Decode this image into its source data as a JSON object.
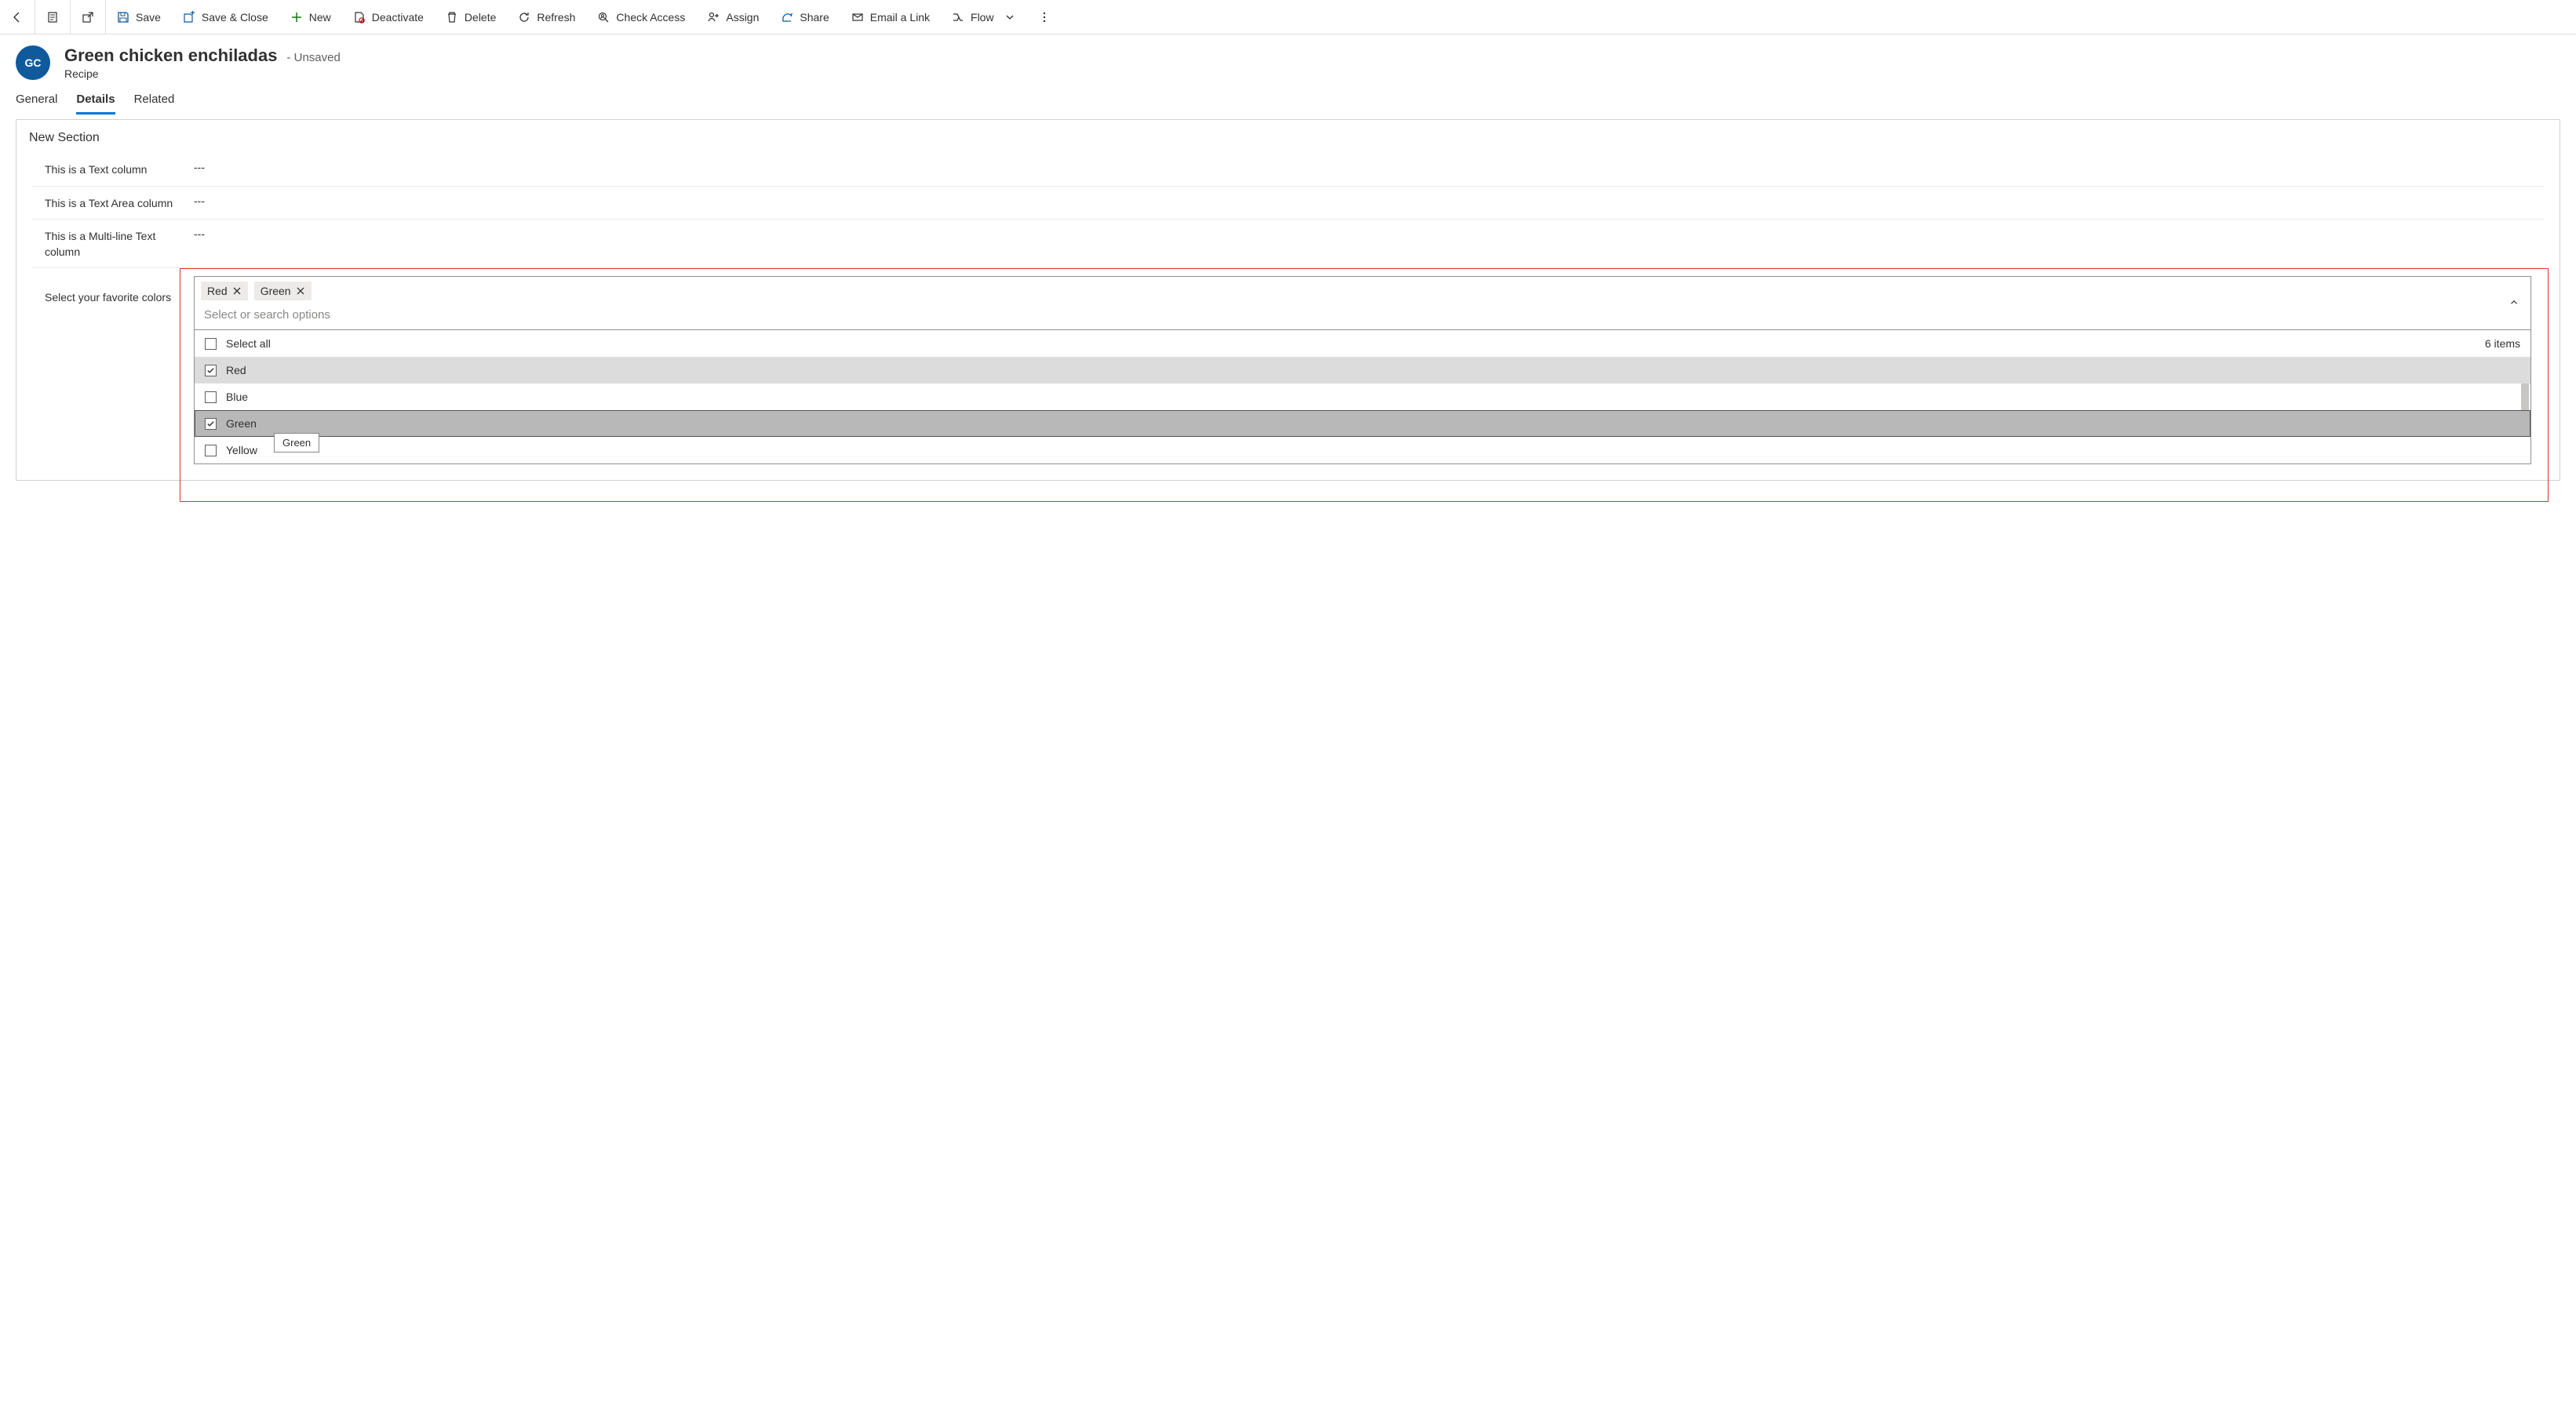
{
  "commandbar": {
    "save": "Save",
    "save_close": "Save & Close",
    "new": "New",
    "deactivate": "Deactivate",
    "delete": "Delete",
    "refresh": "Refresh",
    "check_access": "Check Access",
    "assign": "Assign",
    "share": "Share",
    "email_link": "Email a Link",
    "flow": "Flow"
  },
  "record": {
    "avatar_initials": "GC",
    "title": "Green chicken enchiladas",
    "status": "- Unsaved",
    "entity": "Recipe"
  },
  "tabs": {
    "general": "General",
    "details": "Details",
    "related": "Related"
  },
  "section": {
    "title": "New Section",
    "fields": {
      "text": {
        "label": "This is a Text column",
        "value": "---"
      },
      "textarea": {
        "label": "This is a Text Area column",
        "value": "---"
      },
      "multiline": {
        "label": "This is a Multi-line Text column",
        "value": "---"
      },
      "colors": {
        "label": "Select your favorite colors"
      }
    }
  },
  "multiselect": {
    "chips": [
      "Red",
      "Green"
    ],
    "placeholder": "Select or search options",
    "select_all_label": "Select all",
    "items_count_label": "6 items",
    "options": [
      {
        "label": "Red",
        "checked": true,
        "state": "selected",
        "tooltip": null
      },
      {
        "label": "Blue",
        "checked": false,
        "state": "",
        "tooltip": null
      },
      {
        "label": "Green",
        "checked": true,
        "state": "hover",
        "tooltip": "Green"
      },
      {
        "label": "Yellow",
        "checked": false,
        "state": "",
        "tooltip": null
      }
    ]
  }
}
